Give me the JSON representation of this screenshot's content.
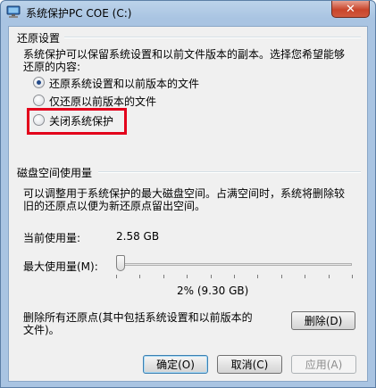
{
  "window": {
    "title": "系统保护PC COE (C:)",
    "close_glyph": "✕"
  },
  "restore_settings": {
    "group_title": "还原设置",
    "description_line1": "系统保护可以保留系统设置和以前文件版本的副本。选择您希望能够",
    "description_line2": "还原的内容:",
    "options": [
      {
        "label": "还原系统设置和以前版本的文件",
        "checked": true
      },
      {
        "label": "仅还原以前版本的文件",
        "checked": false
      },
      {
        "label": "关闭系统保护",
        "checked": false
      }
    ]
  },
  "disk_space": {
    "group_title": "磁盘空间使用量",
    "description_line1": "可以调整用于系统保护的最大磁盘空间。占满空间时，系统将删除较",
    "description_line2": "旧的还原点以便为新还原点留出空间。",
    "current_usage_label": "当前使用量:",
    "current_usage_value": "2.58 GB",
    "max_usage_label": "最大使用量(M):",
    "max_usage_percent": 2,
    "max_usage_text": "2% (9.30 GB)",
    "delete_line1": "删除所有还原点(其中包括系统设置和以前版本的",
    "delete_line2": "文件)。",
    "delete_button": "删除(D)"
  },
  "buttons": {
    "ok": "确定(O)",
    "cancel": "取消(C)",
    "apply": "应用(A)"
  },
  "colors": {
    "highlight": "#e3001b",
    "window_frame": "#a9c4e2",
    "client_bg": "#f0f0f0"
  }
}
